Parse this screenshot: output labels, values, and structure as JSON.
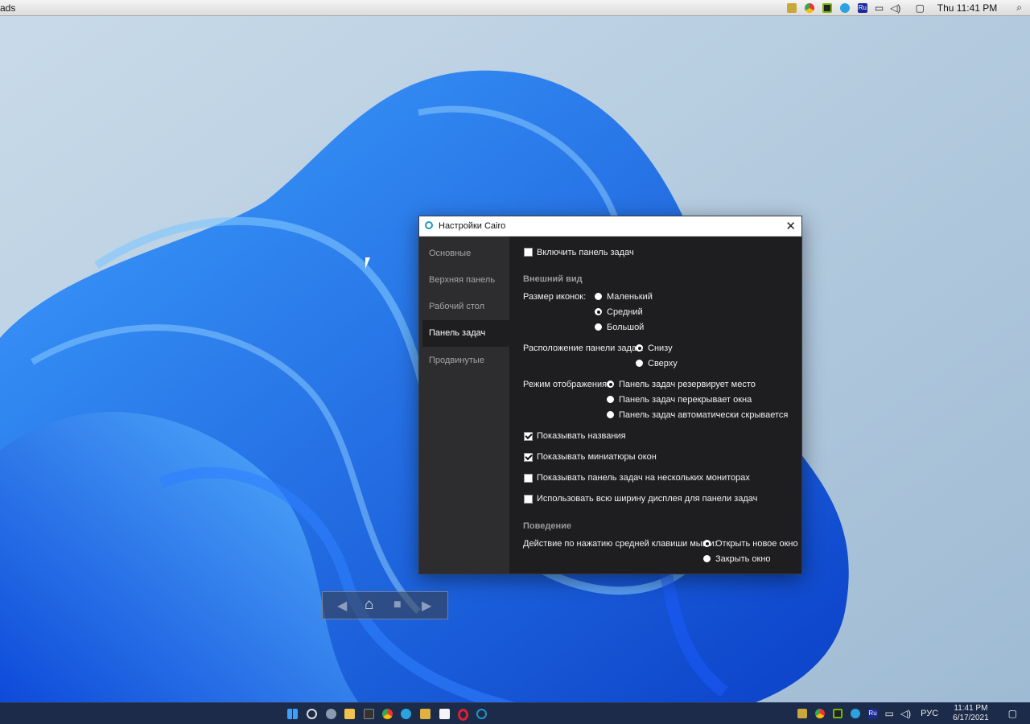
{
  "menubar": {
    "left_text": "ads",
    "clock": "Thu 11:41 PM",
    "tray_icons": [
      "clipboard-icon",
      "chrome-icon",
      "nvidia-icon",
      "telegram-icon",
      "ru-badge-icon",
      "network-icon",
      "volume-icon",
      "notification-icon",
      "search-icon"
    ],
    "ru_label": "Ru"
  },
  "window": {
    "title": "Настройки Cairo",
    "close_glyph": "✕",
    "sidebar": [
      {
        "label": "Основные",
        "active": false
      },
      {
        "label": "Верхняя панель",
        "active": false
      },
      {
        "label": "Рабочий стол",
        "active": false
      },
      {
        "label": "Панель задач",
        "active": true
      },
      {
        "label": "Продвинутые",
        "active": false
      }
    ],
    "enable_taskbar": {
      "label": "Включить панель задач",
      "checked": false
    },
    "appearance": {
      "header": "Внешний вид",
      "icon_size_label": "Размер иконок:",
      "icon_size_options": [
        {
          "label": "Маленький",
          "selected": false
        },
        {
          "label": "Средний",
          "selected": true
        },
        {
          "label": "Большой",
          "selected": false
        }
      ],
      "position_label": "Расположение панели задач:",
      "position_options": [
        {
          "label": "Снизу",
          "selected": true
        },
        {
          "label": "Сверху",
          "selected": false
        }
      ],
      "mode_label": "Режим отображения:",
      "mode_options": [
        {
          "label": "Панель задач резервирует место",
          "selected": true
        },
        {
          "label": "Панель задач перекрывает окна",
          "selected": false
        },
        {
          "label": "Панель задач автоматически скрывается",
          "selected": false
        }
      ],
      "checkboxes": [
        {
          "label": "Показывать названия",
          "checked": true
        },
        {
          "label": "Показывать миниатюры окон",
          "checked": true
        },
        {
          "label": "Показывать панель задач на нескольких мониторах",
          "checked": false
        },
        {
          "label": "Использовать всю ширину дисплея для панели задач",
          "checked": false
        }
      ]
    },
    "behavior": {
      "header": "Поведение",
      "middle_click_label": "Действие по нажатию средней клавиши мыши:",
      "middle_click_options": [
        {
          "label": "Открыть новое окно",
          "selected": true
        },
        {
          "label": "Закрыть окно",
          "selected": false
        }
      ]
    }
  },
  "navwidget": {
    "back": "◀",
    "home": "⌂",
    "folder": "■",
    "forward": "▶"
  },
  "taskbar": {
    "language": "РУС",
    "time": "11:41 PM",
    "date": "6/17/2021",
    "apps": [
      "start-icon",
      "search-icon",
      "settings-icon",
      "explorer-icon",
      "terminal-icon",
      "chrome-icon",
      "telegram-icon",
      "folder-app-icon",
      "notion-icon",
      "opera-icon",
      "cairo-icon"
    ]
  },
  "colors": {
    "window_bg": "#1e1e20",
    "sidebar_bg": "#2d2d2f",
    "taskbar_bg": "#1c2b4a",
    "accent": "#1d98c7"
  }
}
